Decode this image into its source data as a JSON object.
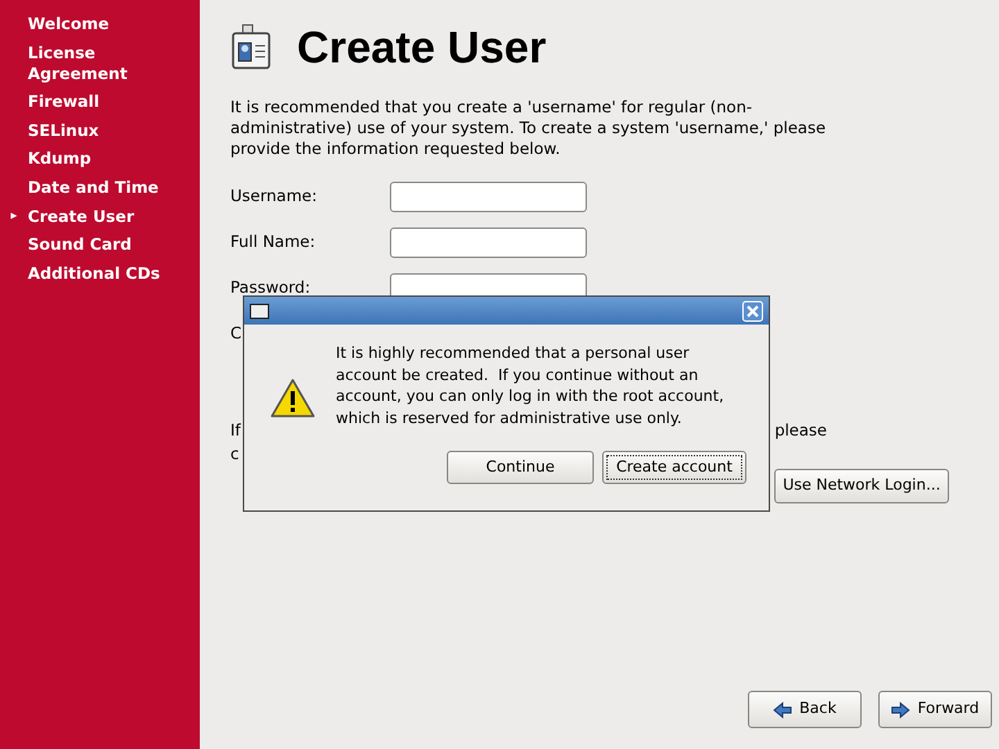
{
  "sidebar": {
    "items": [
      {
        "label": "Welcome",
        "selected": false
      },
      {
        "label": "License Agreement",
        "selected": false
      },
      {
        "label": "Firewall",
        "selected": false
      },
      {
        "label": "SELinux",
        "selected": false
      },
      {
        "label": "Kdump",
        "selected": false
      },
      {
        "label": "Date and Time",
        "selected": false
      },
      {
        "label": "Create User",
        "selected": true
      },
      {
        "label": "Sound Card",
        "selected": false
      },
      {
        "label": "Additional CDs",
        "selected": false
      }
    ]
  },
  "selected_marker": "▸",
  "title": "Create User",
  "intro": "It is recommended that you create a 'username' for regular (non-administrative) use of your system. To create a system 'username,' please provide the information requested below.",
  "fields": [
    {
      "label": "Username:"
    },
    {
      "label": "Full Name:"
    },
    {
      "label": "Password:"
    }
  ],
  "covered_label": "C",
  "covered_line_1": {
    "left": "If",
    "right": "please"
  },
  "covered_line_2": "c",
  "network_login_button": "Use Network Login...",
  "nav_buttons": [
    {
      "kind": "back",
      "label": "Back"
    },
    {
      "kind": "forward",
      "label": "Forward"
    }
  ],
  "dialog": {
    "message": "It is highly recommended that a personal user account be created.  If you continue without an account, you can only log in with the root account, which is reserved for administrative use only.",
    "buttons": [
      {
        "label": "Continue",
        "focused": false
      },
      {
        "label": "Create account",
        "focused": true
      }
    ]
  }
}
